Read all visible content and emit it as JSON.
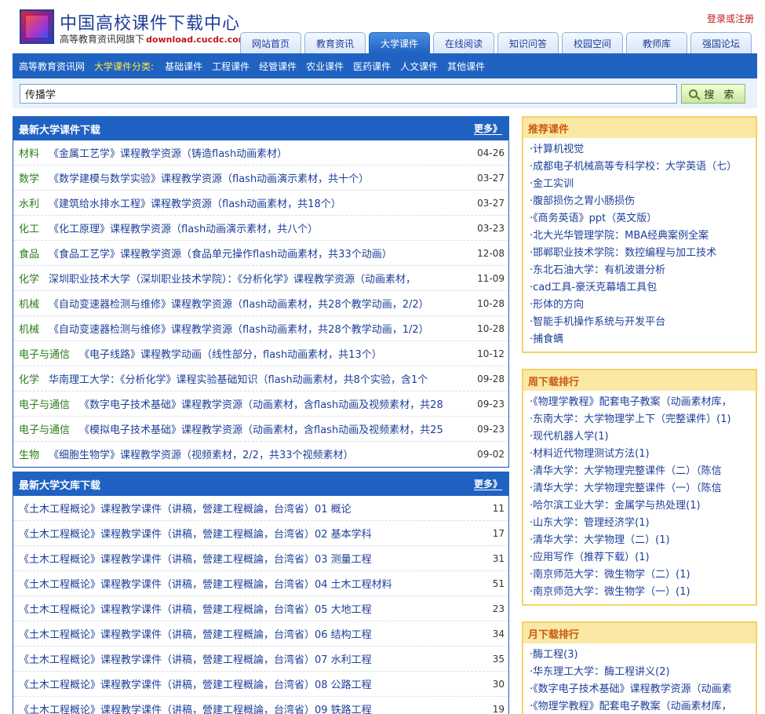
{
  "header": {
    "site_title": "中国高校课件下载中心",
    "site_subtitle": "高等教育资讯网旗下",
    "site_domain": "download.cucdc.com",
    "login_label": "登录或注册"
  },
  "tabs": [
    "网站首页",
    "教育资讯",
    "大学课件",
    "在线阅读",
    "知识问答",
    "校园空间",
    "教师库",
    "强国论坛"
  ],
  "active_tab": "大学课件",
  "category_bar": {
    "home_link": "高等教育资讯网",
    "label": "大学课件分类:",
    "items": [
      "基础课件",
      "工程课件",
      "经管课件",
      "农业课件",
      "医药课件",
      "人文课件",
      "其他课件"
    ]
  },
  "search": {
    "value": "传播学",
    "button_label": "搜 索"
  },
  "latest_courseware": {
    "title": "最新大学课件下载",
    "more_label": "更多》",
    "rows": [
      {
        "cat": "材料",
        "title": "《金属工艺学》课程教学资源（铸造flash动画素材）",
        "date": "04-26"
      },
      {
        "cat": "数学",
        "title": "《数学建模与数学实验》课程教学资源（flash动画演示素材，共十个）",
        "date": "03-27"
      },
      {
        "cat": "水利",
        "title": "《建筑给水排水工程》课程教学资源（flash动画素材，共18个）",
        "date": "03-27"
      },
      {
        "cat": "化工",
        "title": "《化工原理》课程教学资源（flash动画演示素材，共八个）",
        "date": "03-23"
      },
      {
        "cat": "食品",
        "title": "《食品工艺学》课程教学资源（食品单元操作flash动画素材，共33个动画）",
        "date": "12-08"
      },
      {
        "cat": "化学",
        "title": "深圳职业技术大学（深圳职业技术学院）：《分析化学》课程教学资源（动画素材，",
        "date": "11-09"
      },
      {
        "cat": "机械",
        "title": "《自动变速器检测与维修》课程教学资源（flash动画素材，共28个教学动画，2/2）",
        "date": "10-28"
      },
      {
        "cat": "机械",
        "title": "《自动变速器检测与维修》课程教学资源（flash动画素材，共28个教学动画，1/2）",
        "date": "10-28"
      },
      {
        "cat": "电子与通信",
        "title": "《电子线路》课程教学动画（线性部分，flash动画素材，共13个）",
        "date": "10-12"
      },
      {
        "cat": "化学",
        "title": "华南理工大学：《分析化学》课程实验基础知识（flash动画素材，共8个实验，含1个",
        "date": "09-28"
      },
      {
        "cat": "电子与通信",
        "title": "《数字电子技术基础》课程教学资源（动画素材，含flash动画及视频素材，共28",
        "date": "09-23"
      },
      {
        "cat": "电子与通信",
        "title": "《模拟电子技术基础》课程教学资源（动画素材，含flash动画及视频素材，共25",
        "date": "09-23"
      },
      {
        "cat": "生物",
        "title": "《细胞生物学》课程教学资源（视频素材，2/2，共33个视频素材）",
        "date": "09-02"
      }
    ]
  },
  "latest_library": {
    "title": "最新大学文库下载",
    "more_label": "更多》",
    "rows": [
      {
        "title": "《土木工程概论》课程教学课件（讲稿，營建工程概論，台湾省）01 概论",
        "num": "11"
      },
      {
        "title": "《土木工程概论》课程教学课件（讲稿，營建工程概論，台湾省）02 基本学科",
        "num": "17"
      },
      {
        "title": "《土木工程概论》课程教学课件（讲稿，營建工程概論，台湾省）03 测量工程",
        "num": "31"
      },
      {
        "title": "《土木工程概论》课程教学课件（讲稿，營建工程概論，台湾省）04 土木工程材料",
        "num": "51"
      },
      {
        "title": "《土木工程概论》课程教学课件（讲稿，營建工程概論，台湾省）05 大地工程",
        "num": "23"
      },
      {
        "title": "《土木工程概论》课程教学课件（讲稿，營建工程概論，台湾省）06 结构工程",
        "num": "34"
      },
      {
        "title": "《土木工程概论》课程教学课件（讲稿，營建工程概論，台湾省）07 水利工程",
        "num": "35"
      },
      {
        "title": "《土木工程概论》课程教学课件（讲稿，營建工程概論，台湾省）08 公路工程",
        "num": "30"
      },
      {
        "title": "《土木工程概论》课程教学课件（讲稿，營建工程概論，台湾省）09 铁路工程",
        "num": "19"
      }
    ]
  },
  "recommended": {
    "title": "推荐课件",
    "items": [
      "计算机视觉",
      "成都电子机械高等专科学校：大学英语（七）",
      "金工实训",
      "腹部损伤之胃小肠损伤",
      "《商务英语》ppt（英文版）",
      "北大光华管理学院：MBA经典案例全案",
      "邯郸职业技术学院：数控编程与加工技术",
      "东北石油大学：有机波谱分析",
      "cad工具-豪沃克幕墙工具包",
      "形体的方向",
      "智能手机操作系统与开发平台",
      "捕食螨"
    ]
  },
  "weekly": {
    "title": "周下载排行",
    "items": [
      "《物理学教程》配套电子教案（动画素材库，",
      "东南大学：大学物理学上下（完整课件）(1)",
      "现代机器人学(1)",
      "材料近代物理测试方法(1)",
      "清华大学：大学物理完整课件（二）（陈信",
      "清华大学：大学物理完整课件（一）（陈信",
      "哈尔滨工业大学：金属学与热处理(1)",
      "山东大学：管理经济学(1)",
      "清华大学：大学物理（二）(1)",
      "应用写作（推荐下载）(1)",
      "南京师范大学：微生物学（二）(1)",
      "南京师范大学：微生物学（一）(1)"
    ]
  },
  "monthly": {
    "title": "月下载排行",
    "items": [
      "酶工程(3)",
      "华东理工大学：酶工程讲义(2)",
      "《数字电子技术基础》课程教学资源（动画素",
      "《物理学教程》配套电子教案（动画素材库，"
    ]
  }
}
